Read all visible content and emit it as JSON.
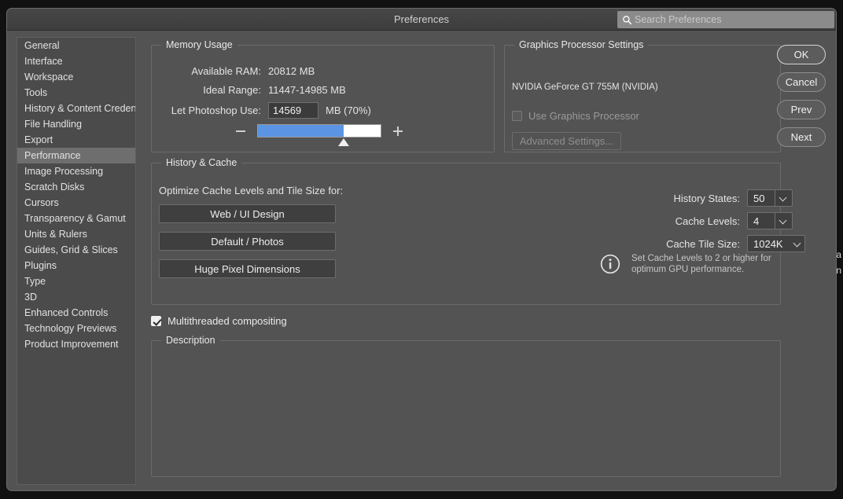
{
  "background": {
    "fragment_1": "ta",
    "fragment_2": "un"
  },
  "window": {
    "title": "Preferences",
    "search": {
      "placeholder": "Search Preferences",
      "value": "",
      "icon": "search-icon"
    }
  },
  "sidebar": {
    "selected": "Performance",
    "items": [
      {
        "label": "General"
      },
      {
        "label": "Interface"
      },
      {
        "label": "Workspace"
      },
      {
        "label": "Tools"
      },
      {
        "label": "History & Content Credentials"
      },
      {
        "label": "File Handling"
      },
      {
        "label": "Export"
      },
      {
        "label": "Performance"
      },
      {
        "label": "Image Processing"
      },
      {
        "label": "Scratch Disks"
      },
      {
        "label": "Cursors"
      },
      {
        "label": "Transparency & Gamut"
      },
      {
        "label": "Units & Rulers"
      },
      {
        "label": "Guides, Grid & Slices"
      },
      {
        "label": "Plugins"
      },
      {
        "label": "Type"
      },
      {
        "label": "3D"
      },
      {
        "label": "Enhanced Controls"
      },
      {
        "label": "Technology Previews"
      },
      {
        "label": "Product Improvement"
      }
    ]
  },
  "memory_usage": {
    "legend": "Memory Usage",
    "available_ram_label": "Available RAM:",
    "available_ram_value": "20812 MB",
    "ideal_range_label": "Ideal Range:",
    "ideal_range_value": "11447-14985 MB",
    "let_photoshop_use_label": "Let Photoshop Use:",
    "let_photoshop_use_value": "14569",
    "let_photoshop_use_suffix": "MB (70%)",
    "slider": {
      "percent": 70,
      "fill_color": "#5b94e3",
      "track_color": "#ffffff"
    },
    "decrease_icon": "minus-icon",
    "increase_icon": "plus-icon"
  },
  "graphics_processor": {
    "legend": "Graphics Processor Settings",
    "detected_card": "NVIDIA GeForce GT 755M (NVIDIA)",
    "use_gpu_label": "Use Graphics Processor",
    "use_gpu_checked": false,
    "advanced_settings_label": "Advanced Settings..."
  },
  "history_cache": {
    "legend": "History & Cache",
    "optimize_label": "Optimize Cache Levels and Tile Size for:",
    "preset_buttons": [
      {
        "label": "Web / UI Design"
      },
      {
        "label": "Default / Photos"
      },
      {
        "label": "Huge Pixel Dimensions"
      }
    ],
    "history_states_label": "History States:",
    "history_states_value": "50",
    "cache_levels_label": "Cache Levels:",
    "cache_levels_value": "4",
    "cache_tile_size_label": "Cache Tile Size:",
    "cache_tile_size_value": "1024K",
    "info_icon": "info-icon",
    "info_line_1": "Set Cache Levels to 2 or higher for",
    "info_line_2": "optimum GPU performance."
  },
  "multithreaded": {
    "label": "Multithreaded compositing",
    "checked": true
  },
  "description": {
    "legend": "Description",
    "body": ""
  },
  "buttons": {
    "ok": "OK",
    "cancel": "Cancel",
    "prev": "Prev",
    "next": "Next"
  }
}
